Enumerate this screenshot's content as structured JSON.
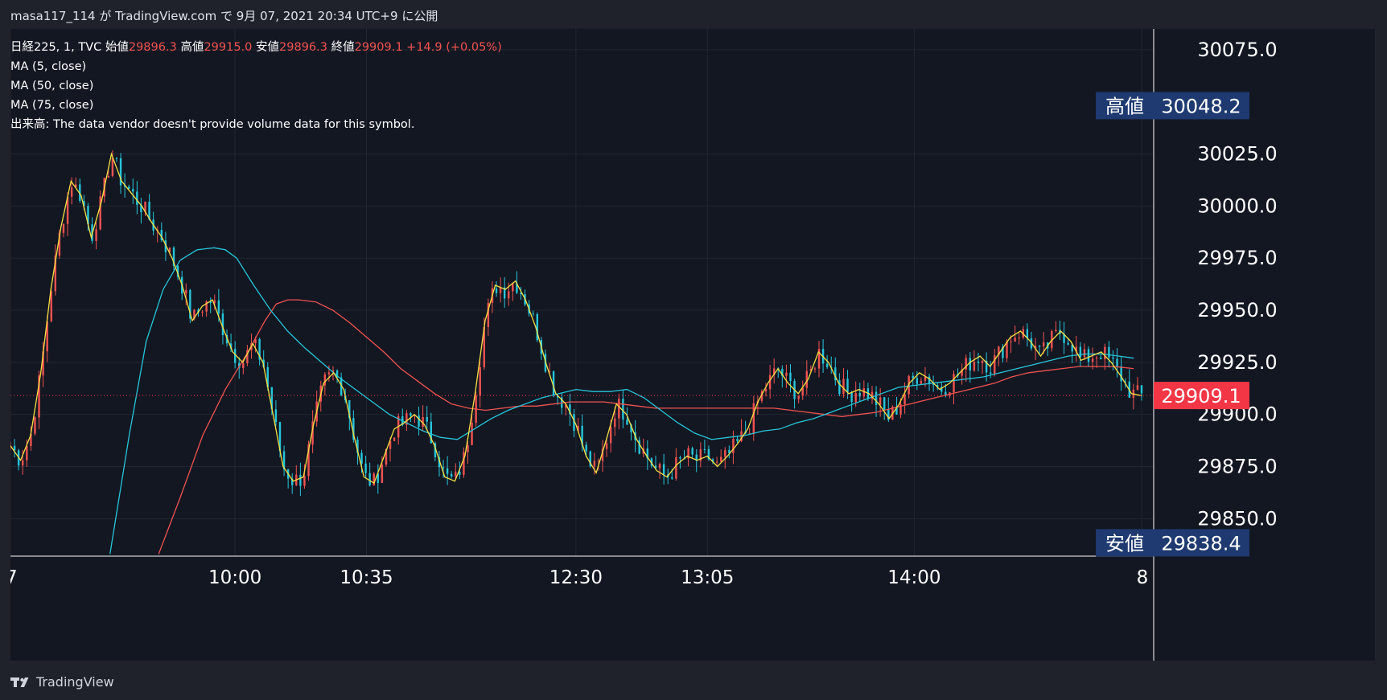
{
  "header": {
    "user": "masa117_114",
    "ga": "が",
    "site": "TradingView.com",
    "de": "で",
    "datetime": "9月 07, 2021 20:34 UTC+9",
    "ni_kokai": "に公開"
  },
  "legend": {
    "symbol": "日経225, 1, TVC",
    "open_label": "始値",
    "open": "29896.3",
    "high_label": "高値",
    "high": "29915.0",
    "low_label": "安値",
    "low": "29896.3",
    "close_label": "終値",
    "close": "29909.1",
    "change": "+14.9 (+0.05%)",
    "ma1": "MA (5, close)",
    "ma2": "MA (50, close)",
    "ma3": "MA (75, close)",
    "volume_note": "出来高: The data vendor doesn't provide volume data for this symbol."
  },
  "footer": {
    "brand": "TradingView"
  },
  "colors": {
    "bg": "#131722",
    "up": "#f05350",
    "down": "#26c6da",
    "ma5": "#f5e143",
    "ma50": "#26c6da",
    "ma75": "#f05350",
    "badge": "#1e3a70",
    "last": "#f23645"
  },
  "chart_data": {
    "type": "candlestick",
    "ylim": [
      29832,
      30085
    ],
    "y_ticks": [
      "30075.0",
      "30025.0",
      "30000.0",
      "29975.0",
      "29950.0",
      "29925.0",
      "29900.0",
      "29875.0",
      "29850.0"
    ],
    "y_tick_values": [
      30075,
      30025,
      30000,
      29975,
      29950,
      29925,
      29900,
      29875,
      29850
    ],
    "x_ticks": [
      "7",
      "10:00",
      "10:35",
      "12:30",
      "13:05",
      "14:00",
      "8"
    ],
    "x_tick_positions": [
      0,
      0.1985,
      0.3147,
      0.4999,
      0.6161,
      0.799,
      1.0
    ],
    "high_badge": {
      "label": "高値",
      "value": "30048.2",
      "y": 30048.2
    },
    "low_badge": {
      "label": "安値",
      "value": "29838.4",
      "y": 29838.4
    },
    "last_price": {
      "value": "29909.1",
      "y": 29909.1
    },
    "close_path": [
      [
        0,
        29885
      ],
      [
        0.01,
        29878
      ],
      [
        0.02,
        29890
      ],
      [
        0.03,
        29920
      ],
      [
        0.04,
        29960
      ],
      [
        0.05,
        29990
      ],
      [
        0.06,
        30012
      ],
      [
        0.07,
        30005
      ],
      [
        0.08,
        29985
      ],
      [
        0.09,
        30002
      ],
      [
        0.1,
        30025
      ],
      [
        0.11,
        30012
      ],
      [
        0.12,
        30006
      ],
      [
        0.13,
        30000
      ],
      [
        0.14,
        29992
      ],
      [
        0.15,
        29985
      ],
      [
        0.16,
        29975
      ],
      [
        0.17,
        29962
      ],
      [
        0.18,
        29945
      ],
      [
        0.19,
        29952
      ],
      [
        0.2,
        29955
      ],
      [
        0.21,
        29942
      ],
      [
        0.22,
        29930
      ],
      [
        0.23,
        29925
      ],
      [
        0.24,
        29934
      ],
      [
        0.25,
        29925
      ],
      [
        0.26,
        29900
      ],
      [
        0.27,
        29875
      ],
      [
        0.28,
        29868
      ],
      [
        0.29,
        29870
      ],
      [
        0.3,
        29895
      ],
      [
        0.31,
        29915
      ],
      [
        0.32,
        29920
      ],
      [
        0.33,
        29912
      ],
      [
        0.34,
        29890
      ],
      [
        0.35,
        29870
      ],
      [
        0.36,
        29867
      ],
      [
        0.37,
        29880
      ],
      [
        0.38,
        29893
      ],
      [
        0.39,
        29896
      ],
      [
        0.4,
        29900
      ],
      [
        0.41,
        29895
      ],
      [
        0.42,
        29885
      ],
      [
        0.43,
        29870
      ],
      [
        0.44,
        29868
      ],
      [
        0.45,
        29880
      ],
      [
        0.46,
        29910
      ],
      [
        0.47,
        29945
      ],
      [
        0.48,
        29962
      ],
      [
        0.49,
        29960
      ],
      [
        0.5,
        29964
      ],
      [
        0.51,
        29955
      ],
      [
        0.52,
        29942
      ],
      [
        0.53,
        29925
      ],
      [
        0.54,
        29910
      ],
      [
        0.55,
        29905
      ],
      [
        0.56,
        29895
      ],
      [
        0.57,
        29880
      ],
      [
        0.58,
        29872
      ],
      [
        0.59,
        29888
      ],
      [
        0.6,
        29905
      ],
      [
        0.61,
        29900
      ],
      [
        0.62,
        29888
      ],
      [
        0.63,
        29880
      ],
      [
        0.64,
        29873
      ],
      [
        0.65,
        29870
      ],
      [
        0.66,
        29876
      ],
      [
        0.67,
        29880
      ],
      [
        0.68,
        29878
      ],
      [
        0.69,
        29880
      ],
      [
        0.7,
        29875
      ],
      [
        0.71,
        29880
      ],
      [
        0.72,
        29886
      ],
      [
        0.73,
        29893
      ],
      [
        0.74,
        29906
      ],
      [
        0.75,
        29915
      ],
      [
        0.76,
        29922
      ],
      [
        0.77,
        29915
      ],
      [
        0.78,
        29910
      ],
      [
        0.79,
        29917
      ],
      [
        0.8,
        29930
      ],
      [
        0.81,
        29925
      ],
      [
        0.82,
        29915
      ],
      [
        0.83,
        29910
      ],
      [
        0.84,
        29912
      ],
      [
        0.85,
        29910
      ],
      [
        0.86,
        29905
      ],
      [
        0.87,
        29898
      ],
      [
        0.88,
        29905
      ],
      [
        0.89,
        29915
      ],
      [
        0.9,
        29920
      ],
      [
        0.91,
        29917
      ],
      [
        0.92,
        29912
      ],
      [
        0.93,
        29915
      ],
      [
        0.94,
        29920
      ],
      [
        0.95,
        29925
      ],
      [
        0.96,
        29928
      ],
      [
        0.97,
        29923
      ],
      [
        0.98,
        29930
      ],
      [
        0.99,
        29937
      ],
      [
        1.0,
        29940
      ],
      [
        1.01,
        29935
      ],
      [
        1.02,
        29928
      ],
      [
        1.03,
        29935
      ],
      [
        1.04,
        29940
      ],
      [
        1.05,
        29935
      ],
      [
        1.06,
        29926
      ],
      [
        1.07,
        29928
      ],
      [
        1.08,
        29930
      ],
      [
        1.09,
        29925
      ],
      [
        1.1,
        29918
      ],
      [
        1.11,
        29910
      ],
      [
        1.12,
        29909
      ]
    ],
    "ma50_path": [
      [
        0.088,
        29833
      ],
      [
        0.105,
        29890
      ],
      [
        0.12,
        29935
      ],
      [
        0.135,
        29960
      ],
      [
        0.15,
        29974
      ],
      [
        0.165,
        29979
      ],
      [
        0.18,
        29980
      ],
      [
        0.19,
        29979
      ],
      [
        0.2,
        29975
      ],
      [
        0.215,
        29962
      ],
      [
        0.23,
        29950
      ],
      [
        0.245,
        29940
      ],
      [
        0.26,
        29932
      ],
      [
        0.275,
        29925
      ],
      [
        0.29,
        29918
      ],
      [
        0.305,
        29912
      ],
      [
        0.32,
        29906
      ],
      [
        0.335,
        29900
      ],
      [
        0.35,
        29896
      ],
      [
        0.365,
        29892
      ],
      [
        0.38,
        29889
      ],
      [
        0.395,
        29888
      ],
      [
        0.41,
        29893
      ],
      [
        0.425,
        29898
      ],
      [
        0.44,
        29902
      ],
      [
        0.455,
        29905
      ],
      [
        0.47,
        29908
      ],
      [
        0.485,
        29910
      ],
      [
        0.5,
        29912
      ],
      [
        0.515,
        29911
      ],
      [
        0.53,
        29911
      ],
      [
        0.545,
        29912
      ],
      [
        0.56,
        29908
      ],
      [
        0.575,
        29902
      ],
      [
        0.59,
        29896
      ],
      [
        0.605,
        29891
      ],
      [
        0.62,
        29888
      ],
      [
        0.635,
        29889
      ],
      [
        0.65,
        29890
      ],
      [
        0.665,
        29892
      ],
      [
        0.68,
        29893
      ],
      [
        0.695,
        29896
      ],
      [
        0.71,
        29898
      ],
      [
        0.725,
        29901
      ],
      [
        0.74,
        29904
      ],
      [
        0.755,
        29907
      ],
      [
        0.77,
        29910
      ],
      [
        0.785,
        29913
      ],
      [
        0.8,
        29914
      ],
      [
        0.815,
        29915
      ],
      [
        0.83,
        29916
      ],
      [
        0.845,
        29917
      ],
      [
        0.86,
        29918
      ],
      [
        0.875,
        29920
      ],
      [
        0.89,
        29922
      ],
      [
        0.905,
        29924
      ],
      [
        0.92,
        29926
      ],
      [
        0.935,
        29928
      ],
      [
        0.95,
        29929
      ],
      [
        0.965,
        29929
      ],
      [
        0.98,
        29928
      ],
      [
        0.993,
        29927
      ]
    ],
    "ma75_path": [
      [
        0.131,
        29833
      ],
      [
        0.15,
        29860
      ],
      [
        0.17,
        29890
      ],
      [
        0.19,
        29912
      ],
      [
        0.21,
        29930
      ],
      [
        0.225,
        29945
      ],
      [
        0.235,
        29953
      ],
      [
        0.245,
        29955
      ],
      [
        0.255,
        29955
      ],
      [
        0.27,
        29954
      ],
      [
        0.285,
        29950
      ],
      [
        0.3,
        29944
      ],
      [
        0.315,
        29937
      ],
      [
        0.33,
        29930
      ],
      [
        0.345,
        29922
      ],
      [
        0.36,
        29916
      ],
      [
        0.375,
        29910
      ],
      [
        0.39,
        29905
      ],
      [
        0.405,
        29903
      ],
      [
        0.42,
        29902
      ],
      [
        0.435,
        29903
      ],
      [
        0.45,
        29904
      ],
      [
        0.465,
        29904
      ],
      [
        0.48,
        29905
      ],
      [
        0.495,
        29906
      ],
      [
        0.51,
        29906
      ],
      [
        0.525,
        29906
      ],
      [
        0.54,
        29905
      ],
      [
        0.555,
        29904
      ],
      [
        0.57,
        29903
      ],
      [
        0.585,
        29903
      ],
      [
        0.6,
        29903
      ],
      [
        0.615,
        29903
      ],
      [
        0.63,
        29903
      ],
      [
        0.645,
        29903
      ],
      [
        0.66,
        29903
      ],
      [
        0.675,
        29903
      ],
      [
        0.69,
        29902
      ],
      [
        0.705,
        29901
      ],
      [
        0.72,
        29900
      ],
      [
        0.735,
        29899
      ],
      [
        0.75,
        29900
      ],
      [
        0.765,
        29901
      ],
      [
        0.78,
        29903
      ],
      [
        0.795,
        29905
      ],
      [
        0.81,
        29907
      ],
      [
        0.825,
        29909
      ],
      [
        0.84,
        29911
      ],
      [
        0.855,
        29913
      ],
      [
        0.87,
        29915
      ],
      [
        0.885,
        29918
      ],
      [
        0.9,
        29920
      ],
      [
        0.915,
        29921
      ],
      [
        0.93,
        29922
      ],
      [
        0.945,
        29923
      ],
      [
        0.96,
        29923
      ],
      [
        0.975,
        29923
      ],
      [
        0.993,
        29922
      ]
    ]
  }
}
